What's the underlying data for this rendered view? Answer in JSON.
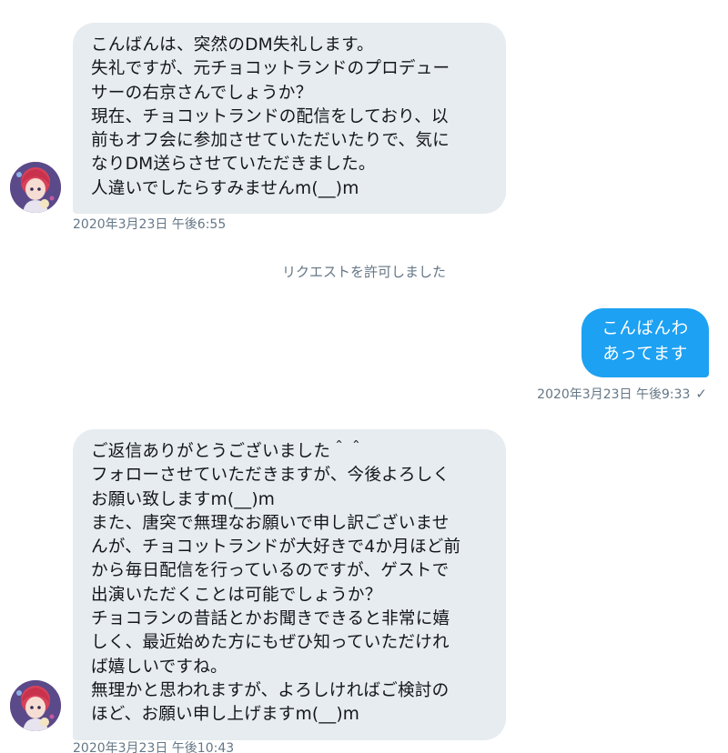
{
  "messages": [
    {
      "sender": "incoming",
      "lines": [
        "こんばんは、突然のDM失礼します。",
        "失礼ですが、元チョコットランドのプロデュー",
        "サーの右京さんでしょうか？",
        "現在、チョコットランドの配信をしており、以",
        "前もオフ会に参加させていただいたりで、気に",
        "なりDM送らさせていただきました。",
        "人違いでしたらすみませんm(__)m"
      ],
      "timestamp": "2020年3月23日 午後6:55"
    },
    {
      "sender": "system",
      "text": "リクエストを許可しました"
    },
    {
      "sender": "outgoing",
      "lines": [
        "こんばんわ",
        "あってます"
      ],
      "timestamp": "2020年3月23日 午後9:33",
      "status_icon": "check-icon"
    },
    {
      "sender": "incoming",
      "lines": [
        "ご返信ありがとうございました＾＾",
        "フォローさせていただきますが、今後よろしく",
        "お願い致しますm(__)m",
        "また、唐突で無理なお願いで申し訳ございませ",
        "んが、チョコットランドが大好きで4か月ほど前",
        "から毎日配信を行っているのですが、ゲストで",
        "出演いただくことは可能でしょうか？",
        "チョコランの昔話とかお聞きできると非常に嬉",
        "しく、最近始めた方にもぜひ知っていただけれ",
        "ば嬉しいですね。",
        "無理かと思われますが、よろしければご検討の",
        "ほど、お願い申し上げますm(__)m"
      ],
      "timestamp": "2020年3月23日 午後10:43"
    }
  ],
  "colors": {
    "incoming_bubble": "#e6ecf0",
    "outgoing_bubble": "#1da1f2",
    "timestamp_text": "#657786",
    "message_text": "#14171a"
  },
  "icons": {
    "avatar": "avatar",
    "read_status": "check-icon"
  }
}
